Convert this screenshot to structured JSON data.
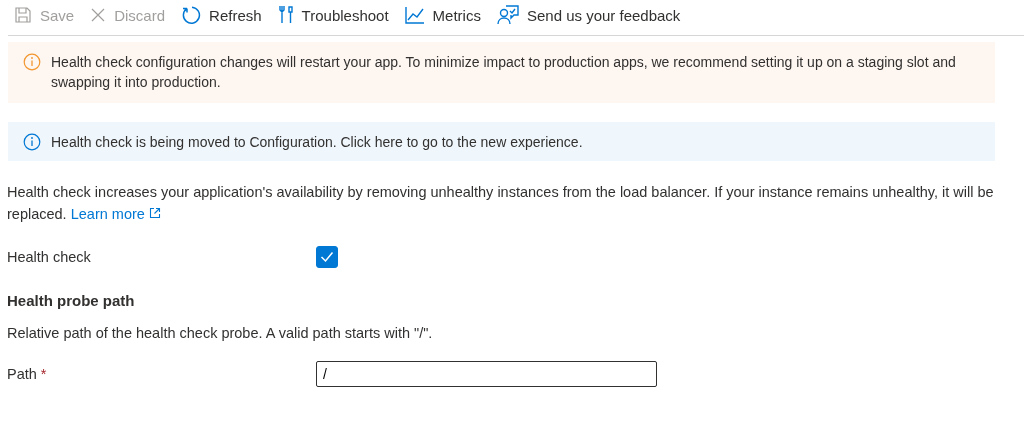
{
  "toolbar": [
    {
      "kind": "save",
      "label": "Save",
      "disabled": true
    },
    {
      "kind": "discard",
      "label": "Discard",
      "disabled": true
    },
    {
      "kind": "refresh",
      "label": "Refresh",
      "disabled": false
    },
    {
      "kind": "troubleshoot",
      "label": "Troubleshoot",
      "disabled": false
    },
    {
      "kind": "metrics",
      "label": "Metrics",
      "disabled": false
    },
    {
      "kind": "feedback",
      "label": "Send us your feedback",
      "disabled": false
    }
  ],
  "banners": [
    {
      "kind": "warning",
      "text": "Health check configuration changes will restart your app. To minimize impact to production apps, we recommend setting it up on a staging slot and swapping it into production."
    },
    {
      "kind": "info",
      "text": "Health check is being moved to Configuration. Click here to go to the new experience."
    }
  ],
  "description": {
    "text": "Health check increases your application's availability by removing unhealthy instances from the load balancer. If your instance remains unhealthy, it will be replaced.",
    "link": "Learn more"
  },
  "health_check": {
    "label": "Health check",
    "checked": true
  },
  "probe": {
    "heading": "Health probe path",
    "description": "Relative path of the health check probe. A valid path starts with \"/\".",
    "path_label": "Path",
    "required_mark": "*",
    "value": "/"
  }
}
